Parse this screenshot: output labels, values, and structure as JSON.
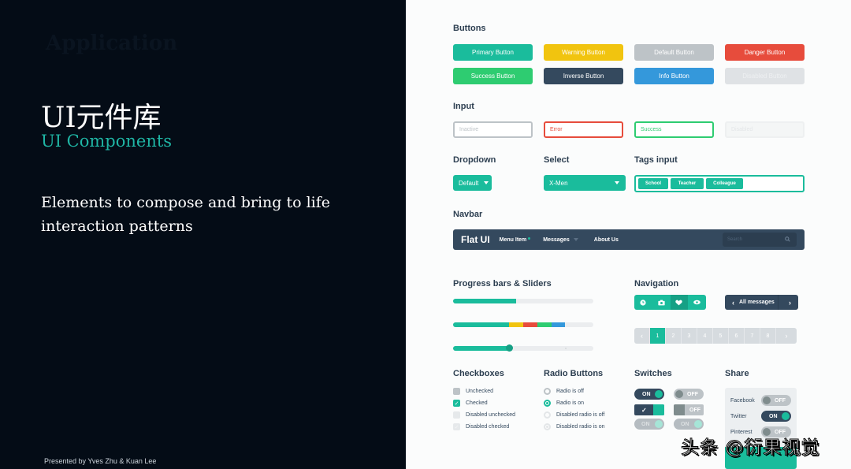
{
  "left_panel": {
    "ghost_text": "Application",
    "title_cn": "UI元件库",
    "title_en": "UI Components",
    "tagline": "Elements to compose and bring to life interaction patterns",
    "credit": "Presented by Yves Zhu & Kuan Lee"
  },
  "colors": {
    "primary": "#1abc9c",
    "warning": "#f1c40f",
    "default": "#bdc3c7",
    "danger": "#e74c3c",
    "success": "#2ecc71",
    "inverse": "#34495e",
    "info": "#3498db",
    "disabled": "#d5d9dc"
  },
  "sections": {
    "buttons": "Buttons",
    "input": "Input",
    "dropdown": "Dropdown",
    "select": "Select",
    "tags_input": "Tags input",
    "navbar": "Navbar",
    "progress": "Progress bars & Sliders",
    "navigation": "Navigation",
    "checkboxes": "Checkboxes",
    "radio": "Radio Buttons",
    "switches": "Switches",
    "share": "Share"
  },
  "buttons": [
    {
      "label": "Primary Button"
    },
    {
      "label": "Warning Button"
    },
    {
      "label": "Default Button"
    },
    {
      "label": "Danger Button"
    },
    {
      "label": "Success Button"
    },
    {
      "label": "Inverse Button"
    },
    {
      "label": "Info Button"
    },
    {
      "label": "Disabled Button"
    }
  ],
  "inputs": [
    {
      "placeholder": "Inactive",
      "state": "inactive"
    },
    {
      "value": "Error",
      "state": "error"
    },
    {
      "value": "Success",
      "state": "success"
    },
    {
      "placeholder": "Disabled",
      "state": "disabled"
    }
  ],
  "dropdown": {
    "label": "Default"
  },
  "select": {
    "value": "X-Men"
  },
  "tags": [
    "School",
    "Teacher",
    "Colleague"
  ],
  "navbar": {
    "brand": "Flat UI",
    "items": [
      "Menu Item",
      "Messages",
      "About Us"
    ],
    "search_placeholder": "Search"
  },
  "progress": {
    "bar1": 0.45,
    "bar2_segments": [
      {
        "color": "#1abc9c",
        "value": 0.4
      },
      {
        "color": "#f1c40f",
        "value": 0.1
      },
      {
        "color": "#e74c3c",
        "value": 0.1
      },
      {
        "color": "#2ecc71",
        "value": 0.1
      },
      {
        "color": "#3498db",
        "value": 0.1
      }
    ],
    "slider": 0.4
  },
  "navigation": {
    "icons": [
      "clock-icon",
      "camera-icon",
      "heart-icon",
      "eye-icon"
    ],
    "active_icon": 2,
    "pager_label": "All messages",
    "pages": [
      "1",
      "2",
      "3",
      "4",
      "5",
      "6",
      "7",
      "8"
    ],
    "active_page": "1"
  },
  "checkboxes": [
    {
      "label": "Unchecked",
      "checked": false,
      "disabled": false
    },
    {
      "label": "Checked",
      "checked": true,
      "disabled": false
    },
    {
      "label": "Disabled unchecked",
      "checked": false,
      "disabled": true
    },
    {
      "label": "Disabled checked",
      "checked": true,
      "disabled": true
    }
  ],
  "radios": [
    {
      "label": "Radio is off",
      "on": false,
      "disabled": false
    },
    {
      "label": "Radio is on",
      "on": true,
      "disabled": false
    },
    {
      "label": "Disabled radio is off",
      "on": false,
      "disabled": true
    },
    {
      "label": "Disabled radio is on",
      "on": true,
      "disabled": true
    }
  ],
  "switches": {
    "on": "ON",
    "off": "OFF"
  },
  "share": [
    {
      "label": "Facebook",
      "state": "OFF"
    },
    {
      "label": "Twitter",
      "state": "ON"
    },
    {
      "label": "Pinterest",
      "state": "OFF"
    }
  ],
  "watermark": "头条 @衍果视觉"
}
